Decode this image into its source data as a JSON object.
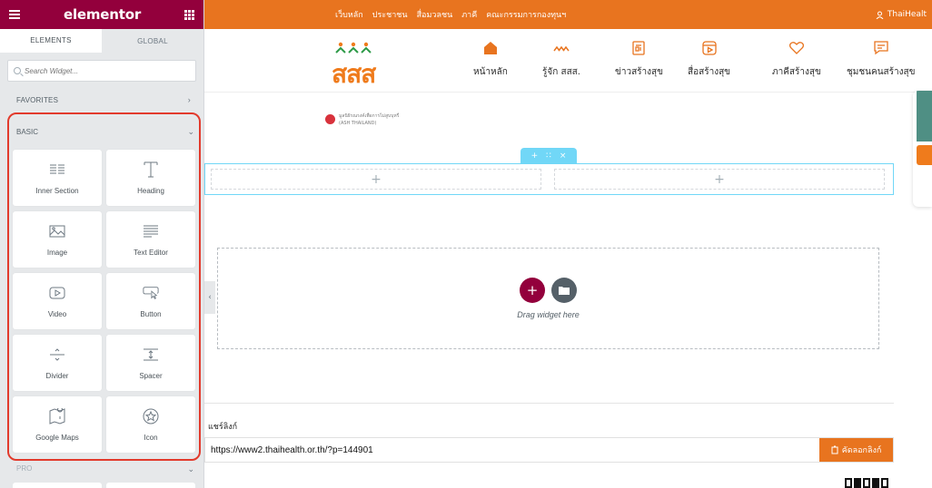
{
  "editor": {
    "brand": "elementor",
    "tabs": [
      "ELEMENTS",
      "GLOBAL"
    ],
    "search": {
      "placeholder": "Search Widget..."
    },
    "favorites_label": "FAVORITES",
    "basic_label": "BASIC",
    "pro_label": "PRO",
    "widgets": [
      {
        "label": "Inner Section",
        "icon": "inner-section-icon"
      },
      {
        "label": "Heading",
        "icon": "heading-icon"
      },
      {
        "label": "Image",
        "icon": "image-icon"
      },
      {
        "label": "Text Editor",
        "icon": "text-editor-icon"
      },
      {
        "label": "Video",
        "icon": "video-icon"
      },
      {
        "label": "Button",
        "icon": "button-icon"
      },
      {
        "label": "Divider",
        "icon": "divider-icon"
      },
      {
        "label": "Spacer",
        "icon": "spacer-icon"
      },
      {
        "label": "Google Maps",
        "icon": "google-maps-icon"
      },
      {
        "label": "Icon",
        "icon": "star-icon"
      }
    ],
    "accent_color": "#93003c",
    "highlight_color": "#e23a2c"
  },
  "site": {
    "topbar": {
      "links": [
        "เว็บหลัก",
        "ประชาชน",
        "สื่อมวลชน",
        "ภาคี",
        "คณะกรรมการกองทุนฯ"
      ],
      "user_label": "ThaiHealt"
    },
    "logo_text": "สสส",
    "menu": [
      {
        "label": "หน้าหลัก",
        "icon": "home-icon"
      },
      {
        "label": "รู้จัก สสส.",
        "icon": "logo-mark-icon"
      },
      {
        "label": "ข่าวสร้างสุข",
        "icon": "news-icon"
      },
      {
        "label": "สื่อสร้างสุข",
        "icon": "media-icon"
      },
      {
        "label": "ภาคีสร้างสุข",
        "icon": "heart-icon"
      },
      {
        "label": "ชุมชนคนสร้างสุข",
        "icon": "chat-icon"
      }
    ],
    "ash_logo": {
      "line1": "มูลนิธิรณรงค์เพื่อการไม่สูบบุหรี่",
      "line2": "(ASH THAILAND)"
    },
    "dropzone_text": "Drag widget here",
    "share": {
      "label": "แชร์ลิงก์",
      "url": "https://www2.thaihealth.or.th/?p=144901",
      "copy_label": "คัดลอกลิงก์"
    },
    "brand_color": "#e8741f",
    "section_color": "#71d7f7"
  }
}
